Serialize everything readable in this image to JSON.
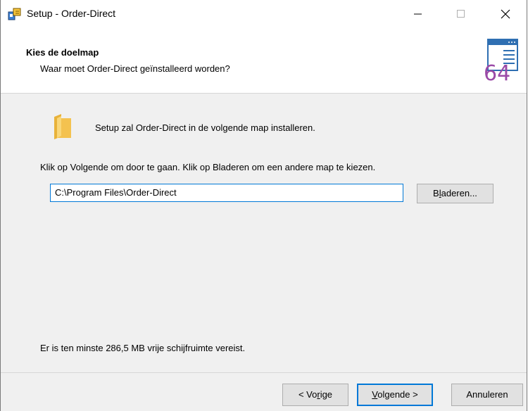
{
  "window": {
    "title": "Setup - Order-Direct",
    "icon": "setup-app-icon",
    "controls": {
      "minimize": "minimize-icon",
      "maximize": "maximize-icon",
      "close": "close-icon"
    }
  },
  "header": {
    "title": "Kies de doelmap",
    "subtitle": "Waar moet Order-Direct geïnstalleerd worden?",
    "icon": "installer-64-icon",
    "icon_text": "64"
  },
  "main": {
    "install_text": "Setup zal Order-Direct in de volgende map installeren.",
    "click_text": "Klik op Volgende om door te gaan. Klik op Bladeren om een andere map te kiezen.",
    "path_value": "C:\\Program Files\\Order-Direct",
    "browse_label": {
      "pre": "B",
      "ul": "l",
      "post": "aderen..."
    },
    "space_text": "Er is ten minste 286,5 MB vrije schijfruimte vereist."
  },
  "footer": {
    "prev": {
      "pre": "< Vo",
      "ul": "r",
      "post": "ige"
    },
    "next": {
      "pre": "",
      "ul": "V",
      "post": "olgende >"
    },
    "cancel": "Annuleren"
  },
  "colors": {
    "accent": "#0078d7",
    "folder": "#f4c24f",
    "icon_purple": "#9b4aa7"
  }
}
